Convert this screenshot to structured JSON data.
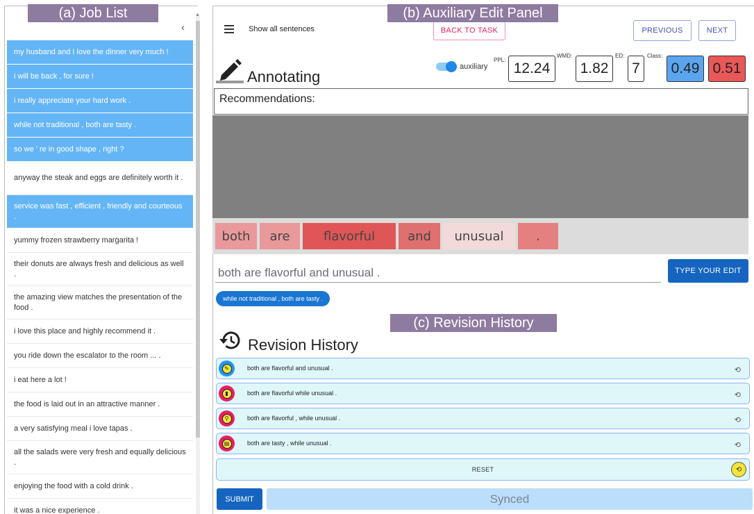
{
  "labels": {
    "job_list": "(a) Job List",
    "aux_panel": "(b) Auxiliary Edit Panel",
    "revision": "(c) Revision History"
  },
  "job_list": {
    "collapse": "‹",
    "items": [
      {
        "text": "my husband and I love the dinner very much !",
        "selected": true
      },
      {
        "text": "i will be back , for sure !",
        "selected": true
      },
      {
        "text": "i really appreciate your hard work .",
        "selected": true
      },
      {
        "text": "while not traditional , both are tasty .",
        "selected": true
      },
      {
        "text": "so we ' re in good shape , right ?",
        "selected": true
      },
      {
        "text": "anyway the steak and eggs are definitely worth it .",
        "selected": false
      },
      {
        "text": "service was fast , efficient , friendly and courteous .",
        "selected": true
      },
      {
        "text": "yummy frozen strawberry margarita !",
        "selected": false
      },
      {
        "text": "their donuts are always fresh and delicious as well .",
        "selected": false
      },
      {
        "text": "the amazing view matches the presentation of the food .",
        "selected": false
      },
      {
        "text": "i love this place and highly recommend it .",
        "selected": false
      },
      {
        "text": "you ride down the escalator to the room ... .",
        "selected": false
      },
      {
        "text": "i eat here a lot !",
        "selected": false
      },
      {
        "text": "the food is laid out in an attractive manner .",
        "selected": false
      },
      {
        "text": "a very satisfying meal i love tapas .",
        "selected": false
      },
      {
        "text": "all the salads were very fresh and equally delicious .",
        "selected": false
      },
      {
        "text": "enjoying the food with a cold drink .",
        "selected": false
      },
      {
        "text": "it was a nice experience .",
        "selected": false
      }
    ]
  },
  "toolbar": {
    "show_all": "Show all sentences",
    "back": "BACK TO TASK",
    "previous": "PREVIOUS",
    "next": "NEXT"
  },
  "annotating": {
    "title": "Annotating",
    "toggle_label": "auxiliary",
    "toggle_on": true
  },
  "metrics": {
    "ppl_label": "PPL:",
    "ppl": "12.24",
    "wmd_label": "WMD:",
    "wmd": "1.82",
    "ed_label": "ED:",
    "ed": "7",
    "class_label": "Class:",
    "class_a": "0.49",
    "class_b": "0.51",
    "class_a_color": "#5ba4f0",
    "class_b_color": "#ea5757"
  },
  "recommendations": {
    "label": "Recommendations:"
  },
  "tokens": [
    {
      "text": "both",
      "color": "#e9999a"
    },
    {
      "text": "are",
      "color": "#e9999a"
    },
    {
      "text": "flavorful",
      "color": "#e05656"
    },
    {
      "text": "and",
      "color": "#e07070"
    },
    {
      "text": "unusual",
      "color": "#f2dada"
    },
    {
      "text": ".",
      "color": "#e58080"
    }
  ],
  "edit": {
    "value": "both are flavorful and unusual .",
    "button": "TYPE YOUR EDIT",
    "chip": "while not traditional , both are tasty ."
  },
  "history": {
    "title": "Revision History",
    "rows": [
      {
        "text": "both are flavorful and unusual .",
        "icon": "pencil-icon",
        "ring": "#2196f3",
        "glyph": "✎"
      },
      {
        "text": "both are flavorful while unusual .",
        "icon": "trash-icon",
        "ring": "#e91e63",
        "glyph": "▮"
      },
      {
        "text": "both are flavorful , while unusual .",
        "icon": "magnifier-icon",
        "ring": "#e91e63",
        "glyph": "⚲"
      },
      {
        "text": "both are tasty , while unusual .",
        "icon": "keyboard-icon",
        "ring": "#e91e63",
        "glyph": "▤"
      }
    ],
    "undo_glyph": "⟲",
    "reset": "RESET"
  },
  "footer": {
    "submit": "SUBMIT",
    "status": "Synced"
  }
}
